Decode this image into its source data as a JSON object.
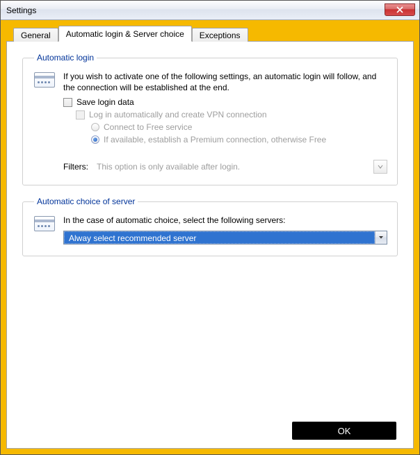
{
  "window": {
    "title": "Settings"
  },
  "tabs": [
    {
      "label": "General"
    },
    {
      "label": "Automatic login & Server choice"
    },
    {
      "label": "Exceptions"
    }
  ],
  "autologin": {
    "legend": "Automatic login",
    "description": "If you wish to activate one of the following settings, an automatic login will follow, and the connection will be established at the end.",
    "save_login": "Save login data",
    "auto_create_vpn": "Log in automatically and create VPN connection",
    "radio_free": "Connect to Free service",
    "radio_premium": "If available, establish a Premium connection, otherwise Free",
    "filters_label": "Filters:",
    "filters_text": "This option is only available after login."
  },
  "server": {
    "legend": "Automatic choice of server",
    "description": "In the case of automatic choice, select the following servers:",
    "selected": "Alway select recommended server"
  },
  "buttons": {
    "ok": "OK"
  }
}
